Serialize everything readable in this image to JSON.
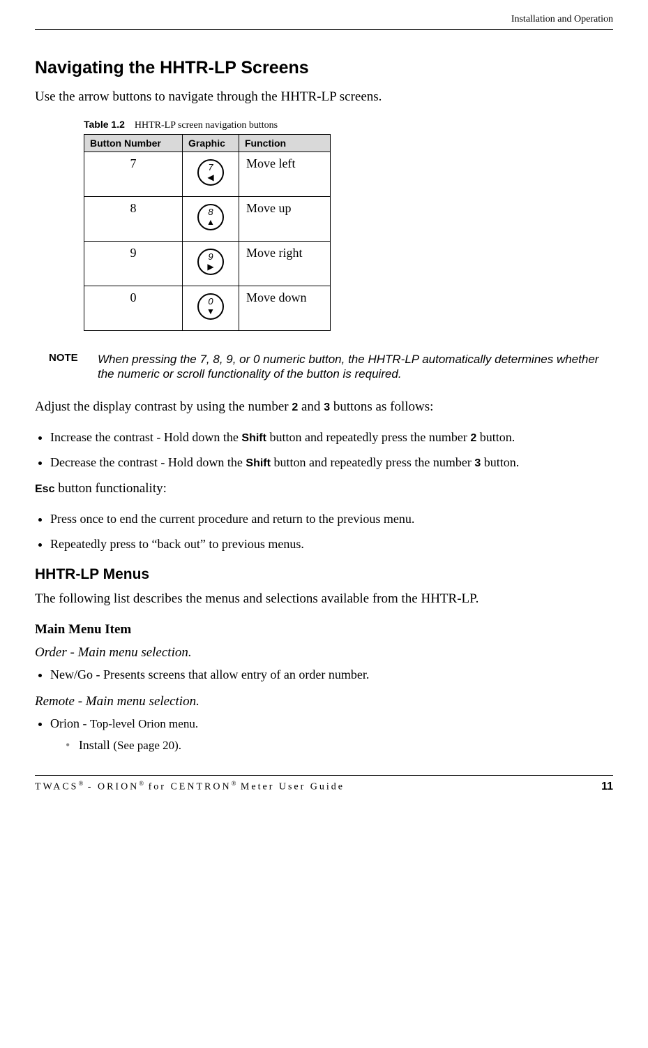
{
  "header": {
    "right": "Installation and Operation"
  },
  "section_title": "Navigating the HHTR-LP Screens",
  "intro": "Use the arrow buttons to navigate through the HHTR-LP screens.",
  "table": {
    "caption_label": "Table 1.2",
    "caption_text": "HHTR-LP screen navigation buttons",
    "headers": {
      "c1": "Button Number",
      "c2": "Graphic",
      "c3": "Function"
    },
    "rows": [
      {
        "num": "7",
        "digit": "7",
        "arrow": "◀",
        "func": "Move left"
      },
      {
        "num": "8",
        "digit": "8",
        "arrow": "▲",
        "func": "Move up"
      },
      {
        "num": "9",
        "digit": "9",
        "arrow": "▶",
        "func": "Move right"
      },
      {
        "num": "0",
        "digit": "0",
        "arrow": "▼",
        "func": "Move down"
      }
    ]
  },
  "note": {
    "label": "NOTE",
    "text": "When pressing the 7, 8, 9, or 0 numeric button, the HHTR-LP automatically determines whether the numeric or scroll functionality of the button is required."
  },
  "contrast_intro_pre": "Adjust the display contrast by using the number ",
  "contrast_2": "2",
  "contrast_mid": " and ",
  "contrast_3": "3",
  "contrast_intro_post": " buttons as follows:",
  "contrast_items": {
    "inc_pre": "Increase the contrast - Hold down the ",
    "shift": "Shift",
    "inc_mid": " button and repeatedly press the number ",
    "inc_num": "2",
    "inc_post": " button.",
    "dec_pre": "Decrease the contrast - Hold down the ",
    "dec_mid": " button and repeatedly press the number ",
    "dec_num": "3",
    "dec_post": " button."
  },
  "esc_label": "Esc",
  "esc_text": " button functionality:",
  "esc_items": {
    "i1": "Press once to end the current procedure and return to the previous menu.",
    "i2": "Repeatedly press to “back out” to previous menus."
  },
  "menus_title": "HHTR-LP Menus",
  "menus_intro": "The following list describes the menus and selections available from the HHTR-LP.",
  "main_menu_heading": "Main Menu Item",
  "order_line": "Order - Main menu selection.",
  "order_item": "New/Go - Presents screens that allow entry of an order number.",
  "remote_line": "Remote - Main menu selection.",
  "remote_orion_pre": "Orion - ",
  "remote_orion_desc": "Top-level Orion menu.",
  "install_pre": "Install ",
  "install_ref": "(See page 20).",
  "footer": {
    "left_1": "TWACS",
    "reg": "®",
    "sep1": " - ORION",
    "sep2": " for CENTRON",
    "tail": " Meter User Guide",
    "page": "11"
  }
}
